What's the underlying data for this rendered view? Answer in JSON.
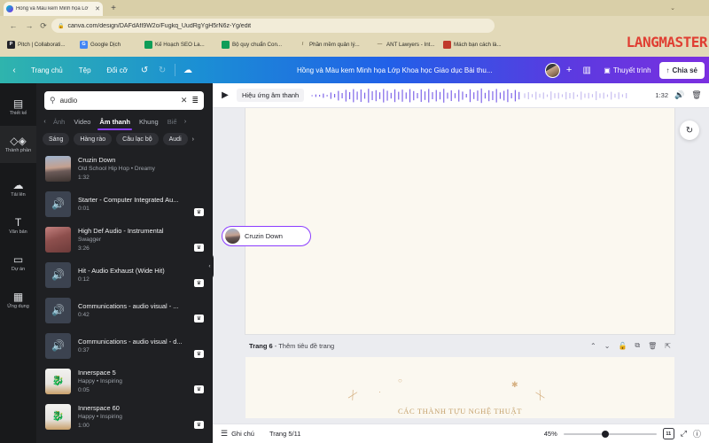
{
  "browser": {
    "tab": {
      "title": "Hồng và Màu kem Minh họa Lớ",
      "close_label": "✕",
      "favicon": "canva-icon"
    },
    "new_tab_label": "+",
    "tabstrip_chevron": "⌄",
    "nav": {
      "back": "←",
      "forward": "→",
      "reload": "⟳"
    },
    "omnibox": {
      "lock": "🔒",
      "url": "canva.com/design/DAFdAfI9W2o/Fugkq_UudRgYgH5rN6z-Yg/edit",
      "placeholder": "Search or type URL"
    },
    "bookmarks": [
      {
        "label": "Pitch | Collaborati...",
        "icon_letter": "P",
        "color": "#23242a"
      },
      {
        "label": "Google Dịch",
        "icon_letter": "G",
        "color": "#4285f4"
      },
      {
        "label": "Kế Hoạch SEO La...",
        "icon_letter": "",
        "color": "#0f9d58"
      },
      {
        "label": "Bộ quy chuẩn Con...",
        "icon_letter": "",
        "color": "#0f9d58"
      },
      {
        "label": "Phần mềm quản lý...",
        "icon_letter": "/",
        "color": "#e2d9b8"
      },
      {
        "label": "ANT Lawyers - Int...",
        "icon_letter": "—",
        "color": "#e2d9b8"
      },
      {
        "label": "Mách bạn cách là...",
        "icon_letter": "",
        "color": "#c0392b"
      }
    ],
    "watermark": "LANGMASTER"
  },
  "canva_topbar": {
    "home_label": "Trang chủ",
    "file_label": "Tệp",
    "resize_label": "Đổi cỡ",
    "undo_icon": "↺",
    "redo_icon": "↻",
    "cloud_icon": "☁",
    "doc_title": "Hồng và Màu kem Minh họa Lớp Khoa học Giáo dục Bài thu...",
    "add_member_label": "+",
    "insights_icon": "▥",
    "present_label": "Thuyết trình",
    "present_icon": "▣",
    "share_label": "Chia sẻ",
    "share_icon": "↑"
  },
  "rail": {
    "items": [
      {
        "label": "Thiết kế",
        "icon": "layout-icon",
        "glyph": "▤",
        "active": false
      },
      {
        "label": "Thành phần",
        "icon": "shapes-icon",
        "glyph": "◇◈",
        "active": true
      },
      {
        "label": "Tải lên",
        "icon": "upload-cloud-icon",
        "glyph": "☁",
        "active": false
      },
      {
        "label": "Văn bản",
        "icon": "text-icon",
        "glyph": "T",
        "active": false
      },
      {
        "label": "Dự án",
        "icon": "folder-icon",
        "glyph": "▭",
        "active": false
      },
      {
        "label": "Ứng dụng",
        "icon": "apps-grid-icon",
        "glyph": "▦",
        "active": false
      }
    ]
  },
  "panel": {
    "search": {
      "value": "audio",
      "placeholder": "Tìm kiếm",
      "search_icon": "search-icon",
      "clear_icon": "close-icon",
      "filter_icon": "sliders-icon"
    },
    "category_tabs": [
      {
        "label": "Ảnh",
        "active": false,
        "faded": true
      },
      {
        "label": "Video",
        "active": false,
        "faded": false
      },
      {
        "label": "Âm thanh",
        "active": true,
        "faded": false
      },
      {
        "label": "Khung",
        "active": false,
        "faded": false
      },
      {
        "label": "Biể",
        "active": false,
        "faded": true
      }
    ],
    "tabs_prev": "‹",
    "tabs_next": "›",
    "chips": [
      "Sáng",
      "Hàng rào",
      "Câu lạc bộ",
      "Audi"
    ],
    "chips_next": "›",
    "results": [
      {
        "title": "Cruzin Down",
        "subtitle": "Old School Hip Hop • Dreamy",
        "duration": "1:32",
        "thumb": "sunset",
        "pro": false
      },
      {
        "title": "Starter - Computer Integrated Au...",
        "subtitle": "",
        "duration": "0:01",
        "thumb": "speaker",
        "pro": true
      },
      {
        "title": "High Def Audio - Instrumental",
        "subtitle": "Swagger",
        "duration": "3:26",
        "thumb": "vinyl",
        "pro": true
      },
      {
        "title": "Hit - Audio Exhaust (Wide Hit)",
        "subtitle": "",
        "duration": "0:12",
        "thumb": "speaker",
        "pro": true
      },
      {
        "title": "Communications - audio visual - ...",
        "subtitle": "",
        "duration": "0:42",
        "thumb": "speaker",
        "pro": true
      },
      {
        "title": "Communications - audio visual - d...",
        "subtitle": "",
        "duration": "0:37",
        "thumb": "speaker",
        "pro": true
      },
      {
        "title": "Innerspace 5",
        "subtitle": "Happy • Inspiring",
        "duration": "0:05",
        "thumb": "dino",
        "pro": true
      },
      {
        "title": "Innerspace 60",
        "subtitle": "Happy • Inspiring",
        "duration": "1:00",
        "thumb": "dino",
        "pro": true
      }
    ],
    "collapse_handle": "‹"
  },
  "editor": {
    "audio_bar": {
      "play_icon": "play-icon",
      "track_name": "Hiệu ứng âm thanh",
      "duration": "1:32",
      "volume_icon": "volume-icon",
      "delete_icon": "trash-icon",
      "waveform_color": "#7b61e8"
    },
    "animate_icon": "animate-icon",
    "page_header": {
      "page_label": "Trang 6",
      "title_placeholder": "- Thêm tiêu đề trang",
      "actions": [
        "chevron-up-icon",
        "chevron-down-icon",
        "lock-icon",
        "duplicate-icon",
        "trash-icon",
        "export-icon"
      ]
    },
    "page6_art_title": "CÁC THÀNH TỰU NGHỆ THUẬT",
    "track_chip": {
      "label": "Cruzin Down"
    },
    "scroll_hint": "⌃"
  },
  "bottom_bar": {
    "notes_icon": "notes-icon",
    "notes_label": "Ghi chú",
    "page_counter": "Trang 5/11",
    "zoom_percent": "45%",
    "grid_label": "11",
    "grid_icon": "pages-grid-icon",
    "fullscreen_icon": "expand-icon",
    "help_icon": "help-icon"
  }
}
